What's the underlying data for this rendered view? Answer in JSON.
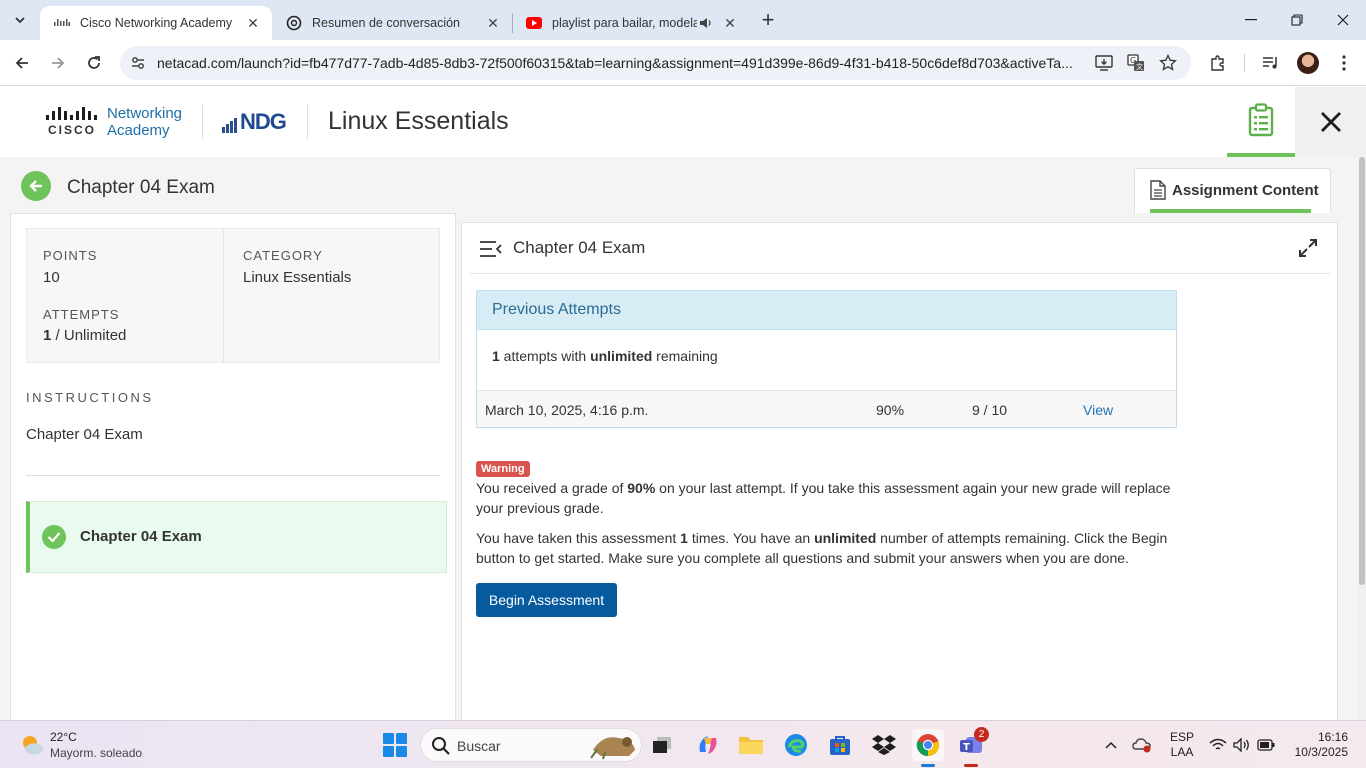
{
  "browser": {
    "tabs": [
      {
        "title": "Cisco Networking Academy",
        "active": true
      },
      {
        "title": "Resumen de conversación",
        "active": false
      },
      {
        "title": "playlist para bailar, modelar",
        "active": false,
        "audio": true
      }
    ],
    "url": "netacad.com/launch?id=fb477d77-7adb-4d85-8db3-72f500f60315&tab=learning&assignment=491d399e-86d9-4f31-b418-50c6def8d703&activeTa..."
  },
  "header": {
    "brand_line1": "Networking",
    "brand_line2": "Academy",
    "cisco_word": "CISCO",
    "partner_logo": "NDG",
    "course_title": "Linux Essentials"
  },
  "page": {
    "title": "Chapter 04 Exam",
    "assignment_tab": "Assignment Content"
  },
  "left": {
    "points_label": "POINTS",
    "points_value": "10",
    "category_label": "CATEGORY",
    "category_value": "Linux Essentials",
    "attempts_label": "ATTEMPTS",
    "attempts_used": "1",
    "attempts_sep": " / ",
    "attempts_limit": "Unlimited",
    "instructions_label": "INSTRUCTIONS",
    "instructions_text": "Chapter 04 Exam",
    "item_title": "Chapter 04 Exam"
  },
  "content": {
    "title": "Chapter 04 Exam",
    "previous_attempts_title": "Previous Attempts",
    "summary_count": "1",
    "summary_mid": " attempts with ",
    "summary_bold": "unlimited",
    "summary_end": " remaining",
    "attempt_rows": [
      {
        "date": "March 10, 2025, 4:16 p.m.",
        "percent": "90%",
        "score": "9 / 10",
        "action": "View"
      }
    ],
    "warning_label": "Warning",
    "warn_p1_a": "You received a grade of ",
    "warn_p1_b": "90%",
    "warn_p1_c": " on your last attempt. If you take this assessment again your new grade will replace your previous grade.",
    "warn_p2_a": "You have taken this assessment ",
    "warn_p2_b": "1",
    "warn_p2_c": " times. You have an ",
    "warn_p2_d": "unlimited",
    "warn_p2_e": " number of attempts remaining. Click the Begin button to get started. Make sure you complete all questions and submit your answers when you are done.",
    "begin_button": "Begin Assessment"
  },
  "taskbar": {
    "temperature": "22°C",
    "weather": "Mayorm. soleado",
    "search_placeholder": "Buscar",
    "teams_badge": "2",
    "lang_line1": "ESP",
    "lang_line2": "LAA",
    "time": "16:16",
    "date": "10/3/2025"
  },
  "colors": {
    "accent_green": "#6ec35a",
    "primary_blue": "#065a9e",
    "warning_red": "#d9534f"
  }
}
